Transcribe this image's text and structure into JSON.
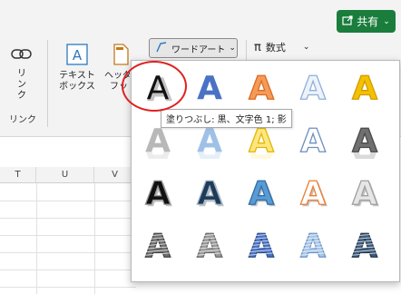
{
  "share_button": {
    "label": "共有",
    "icon": "share-icon"
  },
  "ribbon": {
    "link_label": "リンク",
    "textbox_label_1": "テキスト",
    "textbox_label_2": "ボックス",
    "header_label_1": "ヘッダー",
    "header_label_2": "フッ",
    "wordart_label": "ワードアート",
    "equation_label": "数式",
    "group_link": "リンク"
  },
  "columns": [
    "T",
    "U",
    "V"
  ],
  "wordart_gallery": {
    "glyph": "A",
    "tooltip": "塗りつぶし: 黒、文字色 1; 影",
    "styles": [
      {
        "name": "fill-black-shadow",
        "fill": "#111111",
        "stroke": "none"
      },
      {
        "name": "fill-blue-gradient",
        "fill": "#4a72c4",
        "stroke": "none"
      },
      {
        "name": "fill-orange-outline",
        "fill": "#f29b5a",
        "stroke": "#e06a1c"
      },
      {
        "name": "fill-white-blue-outline",
        "fill": "#eef3fb",
        "stroke": "#8fb0d8"
      },
      {
        "name": "fill-gold",
        "fill": "#f2c200",
        "stroke": "#d49a00"
      },
      {
        "name": "fill-gray-reflection",
        "fill": "#b8b8b8",
        "stroke": "none"
      },
      {
        "name": "fill-blue-reflection",
        "fill": "#9fc1e6",
        "stroke": "none"
      },
      {
        "name": "fill-yellow-reflection",
        "fill": "#ffe680",
        "stroke": "#e0b800"
      },
      {
        "name": "fill-white-outline-blue",
        "fill": "#ffffff",
        "stroke": "#6f8fbf"
      },
      {
        "name": "fill-gray-bevel",
        "fill": "#707070",
        "stroke": "#4a4a4a"
      },
      {
        "name": "fill-black-white-outline",
        "fill": "#111111",
        "stroke": "#999999"
      },
      {
        "name": "fill-dark-blue-outline",
        "fill": "#1f3b55",
        "stroke": "#9fb7cf"
      },
      {
        "name": "fill-blue-shadow",
        "fill": "#5b9bd5",
        "stroke": "#2f6ea8"
      },
      {
        "name": "fill-white-orange-outline",
        "fill": "#ffffff",
        "stroke": "#ed7d31"
      },
      {
        "name": "fill-silver-3d",
        "fill": "#e6e6e6",
        "stroke": "#a0a0a0"
      },
      {
        "name": "pattern-gray-stripes",
        "fill": "#6e6e6e",
        "stroke": "#444444"
      },
      {
        "name": "pattern-gray-dots",
        "fill": "#9a9a9a",
        "stroke": "#6a6a6a"
      },
      {
        "name": "pattern-blue-stripes",
        "fill": "#4a72c4",
        "stroke": "#2c4f8c"
      },
      {
        "name": "pattern-light-blue-stripes",
        "fill": "#a9c6e8",
        "stroke": "#6f96c8"
      },
      {
        "name": "pattern-dark-blue-stripes",
        "fill": "#3c5a7a",
        "stroke": "#22384f"
      }
    ]
  }
}
